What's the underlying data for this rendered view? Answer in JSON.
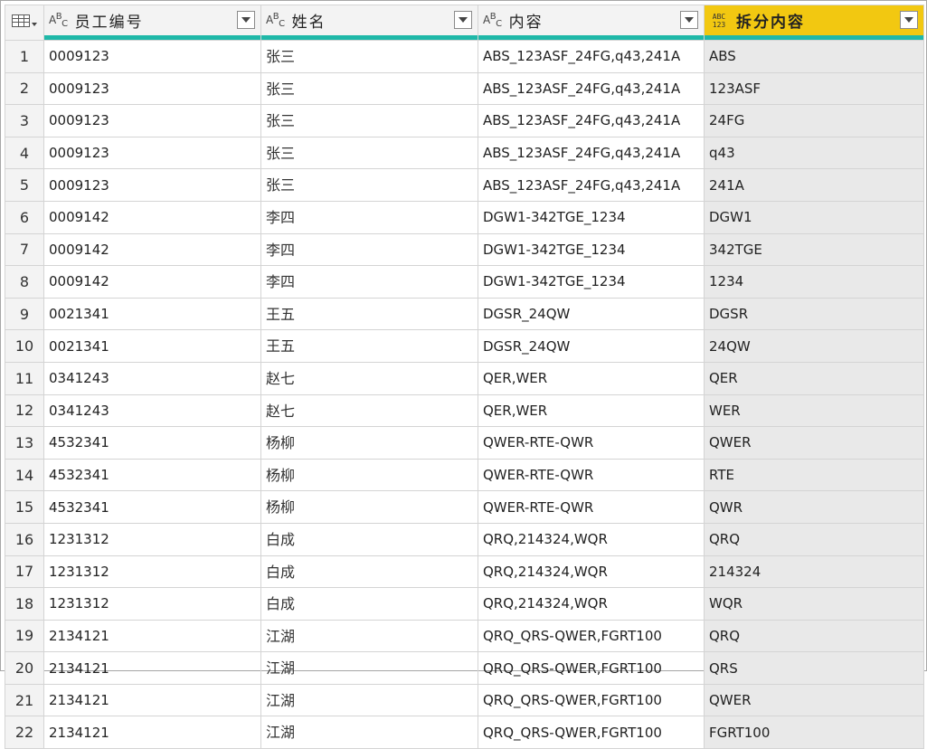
{
  "columns": [
    {
      "type": "ABC",
      "label": "员工编号"
    },
    {
      "type": "ABC",
      "label": "姓名"
    },
    {
      "type": "ABC",
      "label": "内容"
    },
    {
      "type": "ABC123",
      "label": "拆分内容"
    }
  ],
  "type_icons": {
    "abc_main": "A",
    "abc_sup": "B",
    "abc_sub": "C",
    "any_top": "ABC",
    "any_bottom": "123"
  },
  "colors": {
    "selected_header": "#f2c811",
    "quality_bar": "#1fb8a8"
  },
  "icons": {
    "table": "table-icon",
    "dropdown": "chevron-down-icon"
  },
  "rows": [
    {
      "idx": "1",
      "emp": "0009123",
      "name": "张三",
      "content": "ABS_123ASF_24FG,q43,241A",
      "split": "ABS"
    },
    {
      "idx": "2",
      "emp": "0009123",
      "name": "张三",
      "content": "ABS_123ASF_24FG,q43,241A",
      "split": "123ASF"
    },
    {
      "idx": "3",
      "emp": "0009123",
      "name": "张三",
      "content": "ABS_123ASF_24FG,q43,241A",
      "split": "24FG"
    },
    {
      "idx": "4",
      "emp": "0009123",
      "name": "张三",
      "content": "ABS_123ASF_24FG,q43,241A",
      "split": "q43"
    },
    {
      "idx": "5",
      "emp": "0009123",
      "name": "张三",
      "content": "ABS_123ASF_24FG,q43,241A",
      "split": "241A"
    },
    {
      "idx": "6",
      "emp": "0009142",
      "name": "李四",
      "content": "DGW1-342TGE_1234",
      "split": "DGW1"
    },
    {
      "idx": "7",
      "emp": "0009142",
      "name": "李四",
      "content": "DGW1-342TGE_1234",
      "split": "342TGE"
    },
    {
      "idx": "8",
      "emp": "0009142",
      "name": "李四",
      "content": "DGW1-342TGE_1234",
      "split": "1234"
    },
    {
      "idx": "9",
      "emp": "0021341",
      "name": "王五",
      "content": "DGSR_24QW",
      "split": "DGSR"
    },
    {
      "idx": "10",
      "emp": "0021341",
      "name": "王五",
      "content": "DGSR_24QW",
      "split": "24QW"
    },
    {
      "idx": "11",
      "emp": "0341243",
      "name": "赵七",
      "content": "QER,WER",
      "split": "QER"
    },
    {
      "idx": "12",
      "emp": "0341243",
      "name": "赵七",
      "content": "QER,WER",
      "split": "WER"
    },
    {
      "idx": "13",
      "emp": "4532341",
      "name": "杨柳",
      "content": "QWER-RTE-QWR",
      "split": "QWER"
    },
    {
      "idx": "14",
      "emp": "4532341",
      "name": "杨柳",
      "content": "QWER-RTE-QWR",
      "split": "RTE"
    },
    {
      "idx": "15",
      "emp": "4532341",
      "name": "杨柳",
      "content": "QWER-RTE-QWR",
      "split": "QWR"
    },
    {
      "idx": "16",
      "emp": "1231312",
      "name": "白成",
      "content": "QRQ,214324,WQR",
      "split": "QRQ"
    },
    {
      "idx": "17",
      "emp": "1231312",
      "name": "白成",
      "content": "QRQ,214324,WQR",
      "split": "214324"
    },
    {
      "idx": "18",
      "emp": "1231312",
      "name": "白成",
      "content": "QRQ,214324,WQR",
      "split": "WQR"
    },
    {
      "idx": "19",
      "emp": "2134121",
      "name": "江湖",
      "content": "QRQ_QRS-QWER,FGRT100",
      "split": "QRQ"
    },
    {
      "idx": "20",
      "emp": "2134121",
      "name": "江湖",
      "content": "QRQ_QRS-QWER,FGRT100",
      "split": "QRS"
    },
    {
      "idx": "21",
      "emp": "2134121",
      "name": "江湖",
      "content": "QRQ_QRS-QWER,FGRT100",
      "split": "QWER"
    },
    {
      "idx": "22",
      "emp": "2134121",
      "name": "江湖",
      "content": "QRQ_QRS-QWER,FGRT100",
      "split": "FGRT100"
    }
  ]
}
